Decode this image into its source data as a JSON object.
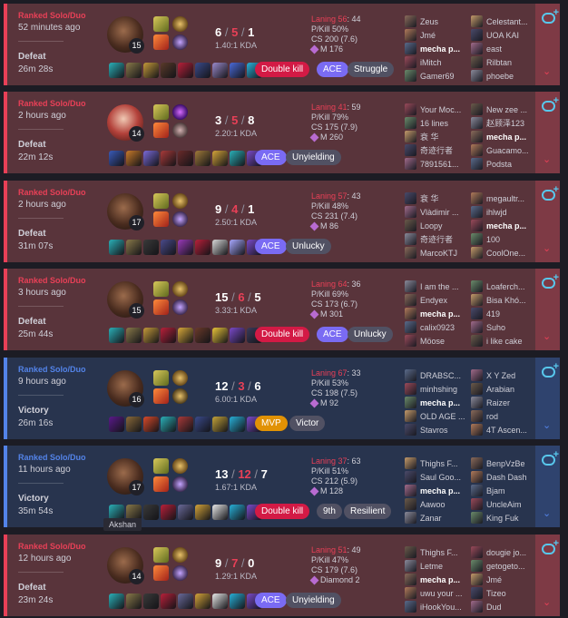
{
  "tooltip": "Akshan",
  "matches": [
    {
      "result_type": "loss",
      "queue": "Ranked Solo/Duo",
      "ago": "52 minutes ago",
      "result": "Defeat",
      "duration": "26m 28s",
      "champion_level": "15",
      "kills": "6",
      "deaths": "5",
      "assists": "1",
      "kda": "1.40:1 KDA",
      "badges": [
        {
          "label": "Double kill",
          "style": "red"
        },
        {
          "label": "ACE",
          "style": "purple"
        },
        {
          "label": "Struggle",
          "style": "grey"
        }
      ],
      "laning_label": "Laning 56",
      "laning_rest": ": 44",
      "pkill": "P/Kill 50%",
      "cs": "CS 200 (7.6)",
      "mmr": "M 176",
      "team1": [
        "Zeus",
        "Jmé",
        "mecha p...",
        "iMitch",
        "Gamer69"
      ],
      "team2": [
        "Celestant...",
        "UOA KAI",
        "east",
        "Rilbtan",
        "phoebe"
      ],
      "me_team": 1,
      "me_index": 2
    },
    {
      "result_type": "loss",
      "queue": "Ranked Solo/Duo",
      "ago": "2 hours ago",
      "result": "Defeat",
      "duration": "22m 12s",
      "champion_level": "14",
      "kills": "3",
      "deaths": "5",
      "assists": "8",
      "kda": "2.20:1 KDA",
      "badges": [
        {
          "label": "ACE",
          "style": "purple"
        },
        {
          "label": "Unyielding",
          "style": "grey"
        }
      ],
      "laning_label": "Laning 41",
      "laning_rest": ": 59",
      "pkill": "P/Kill 79%",
      "cs": "CS 175 (7.9)",
      "mmr": "M 260",
      "team1": [
        "Your Moc...",
        "16 lines",
        "衰 华",
        "奇迹行者",
        "7891561..."
      ],
      "team2": [
        "New zee ...",
        "赵顾泽123",
        "mecha p...",
        "Guacamo...",
        "Podsta"
      ],
      "me_team": 2,
      "me_index": 2
    },
    {
      "result_type": "loss",
      "queue": "Ranked Solo/Duo",
      "ago": "2 hours ago",
      "result": "Defeat",
      "duration": "31m 07s",
      "champion_level": "17",
      "kills": "9",
      "deaths": "4",
      "assists": "1",
      "kda": "2.50:1 KDA",
      "badges": [
        {
          "label": "ACE",
          "style": "purple"
        },
        {
          "label": "Unlucky",
          "style": "grey"
        }
      ],
      "laning_label": "Laning 57",
      "laning_rest": ": 43",
      "pkill": "P/Kill 48%",
      "cs": "CS 231 (7.4)",
      "mmr": "M 86",
      "team1": [
        "衰 华",
        "Vlàdimir ...",
        "Loopy",
        "奇迹行者",
        "MarcoKTJ"
      ],
      "team2": [
        "megaultr...",
        "ihlwjd",
        "mecha p...",
        "100",
        "CoolOne..."
      ],
      "me_team": 2,
      "me_index": 2
    },
    {
      "result_type": "loss",
      "queue": "Ranked Solo/Duo",
      "ago": "3 hours ago",
      "result": "Defeat",
      "duration": "25m 44s",
      "champion_level": "15",
      "kills": "15",
      "deaths": "6",
      "assists": "5",
      "kda": "3.33:1 KDA",
      "badges": [
        {
          "label": "Double kill",
          "style": "red"
        },
        {
          "label": "ACE",
          "style": "purple"
        },
        {
          "label": "Unlucky",
          "style": "grey"
        }
      ],
      "laning_label": "Laning 64",
      "laning_rest": ": 36",
      "pkill": "P/Kill 69%",
      "cs": "CS 173 (6.7)",
      "mmr": "M 301",
      "team1": [
        "I am the ...",
        "Endyex",
        "mecha p...",
        "calix0923",
        "Möose"
      ],
      "team2": [
        "Loaferch...",
        "Bisa Khó...",
        "419",
        "Suho",
        "i like cake"
      ],
      "me_team": 1,
      "me_index": 2
    },
    {
      "result_type": "win",
      "queue": "Ranked Solo/Duo",
      "ago": "9 hours ago",
      "result": "Victory",
      "duration": "26m 16s",
      "champion_level": "16",
      "kills": "12",
      "deaths": "3",
      "assists": "6",
      "kda": "6.00:1 KDA",
      "badges": [
        {
          "label": "MVP",
          "style": "gold"
        },
        {
          "label": "Victor",
          "style": "grey"
        }
      ],
      "laning_label": "Laning 67",
      "laning_rest": ": 33",
      "pkill": "P/Kill 53%",
      "cs": "CS 198 (7.5)",
      "mmr": "M 92",
      "team1": [
        "DRABSC...",
        "minhshing",
        "mecha p...",
        "OLD AGE ...",
        "Stavros"
      ],
      "team2": [
        "X Y Zed",
        "Arabian",
        "Raizer",
        "rod",
        "4T Ascen..."
      ],
      "me_team": 1,
      "me_index": 2
    },
    {
      "result_type": "win",
      "queue": "Ranked Solo/Duo",
      "ago": "11 hours ago",
      "result": "Victory",
      "duration": "35m 54s",
      "champion_level": "17",
      "kills": "13",
      "deaths": "12",
      "assists": "7",
      "kda": "1.67:1 KDA",
      "badges": [
        {
          "label": "Double kill",
          "style": "red"
        },
        {
          "label": "9th",
          "style": "grey"
        },
        {
          "label": "Resilient",
          "style": "grey"
        }
      ],
      "laning_label": "Laning 37",
      "laning_rest": ": 63",
      "pkill": "P/Kill 51%",
      "cs": "CS 212 (5.9)",
      "mmr": "M 128",
      "team1": [
        "Thighs F...",
        "Saul Goo...",
        "mecha p...",
        "Aawoo",
        "Zanar"
      ],
      "team2": [
        "BenpVzBe",
        "Dash Dash",
        "Bjam",
        "UncleAim",
        "King Fuk"
      ],
      "me_team": 1,
      "me_index": 2
    },
    {
      "result_type": "loss",
      "queue": "Ranked Solo/Duo",
      "ago": "12 hours ago",
      "result": "Defeat",
      "duration": "23m 24s",
      "champion_level": "14",
      "kills": "9",
      "deaths": "7",
      "assists": "0",
      "kda": "1.29:1 KDA",
      "badges": [
        {
          "label": "ACE",
          "style": "purple"
        },
        {
          "label": "Unyielding",
          "style": "grey"
        }
      ],
      "laning_label": "Laning 51",
      "laning_rest": ": 49",
      "pkill": "P/Kill 47%",
      "cs": "CS 179 (7.6)",
      "mmr": "Diamond 2",
      "team1": [
        "Thighs F...",
        "Letme",
        "mecha p...",
        "uwu your ...",
        "iHookYou..."
      ],
      "team2": [
        "dougie jo...",
        "getogeto...",
        "Jmé",
        "Tizeo",
        "Dud"
      ],
      "me_team": 1,
      "me_index": 2
    }
  ]
}
